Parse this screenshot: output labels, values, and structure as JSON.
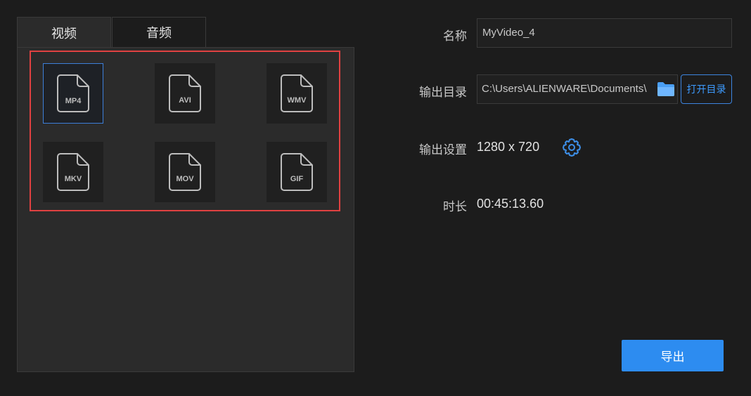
{
  "tabs": {
    "video": "视频",
    "audio": "音频"
  },
  "formats": [
    "MP4",
    "AVI",
    "WMV",
    "MKV",
    "MOV",
    "GIF"
  ],
  "selected_format": "MP4",
  "fields": {
    "name_label": "名称",
    "name_value": "MyVideo_4",
    "output_dir_label": "输出目录",
    "output_dir_value": "C:\\Users\\ALIENWARE\\Documents\\",
    "open_dir_button": "打开目录",
    "output_settings_label": "输出设置",
    "resolution": "1280 x 720",
    "duration_label": "时长",
    "duration_value": "00:45:13.60"
  },
  "export_button": "导出",
  "colors": {
    "accent": "#2d8cf0",
    "highlight_border": "#e04141",
    "selected_border": "#3d7fd9"
  },
  "icons": {
    "folder": "folder-icon",
    "settings": "gear-icon",
    "file": "file-icon"
  }
}
